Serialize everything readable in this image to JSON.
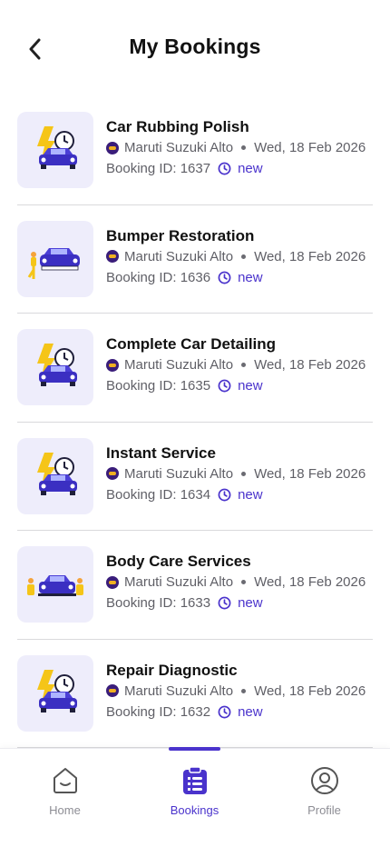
{
  "header": {
    "title": "My Bookings"
  },
  "bookings": [
    {
      "service": "Car Rubbing Polish",
      "car": "Maruti Suzuki Alto",
      "date": "Wed, 18 Feb 2026",
      "booking_id": "Booking ID: 1637",
      "status": "new",
      "thumb": "car-bolt-clock"
    },
    {
      "service": "Bumper Restoration",
      "car": "Maruti Suzuki Alto",
      "date": "Wed, 18 Feb 2026",
      "booking_id": "Booking ID: 1636",
      "status": "new",
      "thumb": "car-painter"
    },
    {
      "service": "Complete Car Detailing",
      "car": "Maruti Suzuki Alto",
      "date": "Wed, 18 Feb 2026",
      "booking_id": "Booking ID: 1635",
      "status": "new",
      "thumb": "car-bolt-clock"
    },
    {
      "service": "Instant Service",
      "car": "Maruti Suzuki Alto",
      "date": "Wed, 18 Feb 2026",
      "booking_id": "Booking ID: 1634",
      "status": "new",
      "thumb": "car-bolt-clock"
    },
    {
      "service": "Body Care Services",
      "car": "Maruti Suzuki Alto",
      "date": "Wed, 18 Feb 2026",
      "booking_id": "Booking ID: 1633",
      "status": "new",
      "thumb": "car-mechanics"
    },
    {
      "service": "Repair Diagnostic",
      "car": "Maruti Suzuki Alto",
      "date": "Wed, 18 Feb 2026",
      "booking_id": "Booking ID: 1632",
      "status": "new",
      "thumb": "car-bolt-clock"
    }
  ],
  "nav": {
    "home": "Home",
    "bookings": "Bookings",
    "profile": "Profile",
    "active": "bookings"
  },
  "colors": {
    "accent": "#4a33cc",
    "thumb_bg": "#eeedfb",
    "bolt": "#f5c518"
  }
}
